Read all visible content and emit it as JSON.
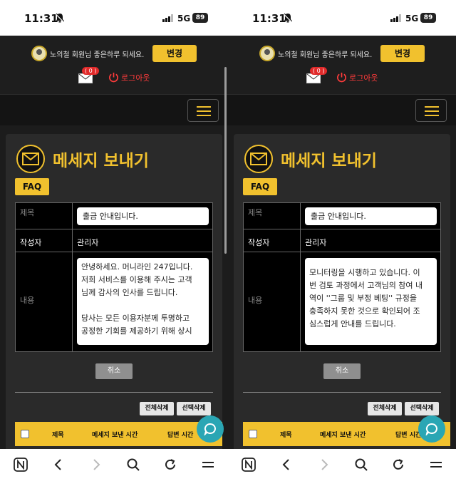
{
  "status": {
    "time": "11:31",
    "network": "5G",
    "battery": "89"
  },
  "header": {
    "greeting": "노의철 회원님 좋은하루 되세요.",
    "change_label": "변경",
    "mail_count": "( 0 )",
    "logout_label": "로그아웃"
  },
  "page": {
    "title": "메세지 보내기",
    "faq_label": "FAQ",
    "form": {
      "subject_label": "제목",
      "subject_value": "출금 안내입니다.",
      "author_label": "작성자",
      "author_value": "관리자",
      "content_label": "내용"
    },
    "cancel_label": "취소",
    "delete_all_label": "전체삭제",
    "delete_selected_label": "선택삭제",
    "list_columns": {
      "subject": "제목",
      "sent_time": "메세지 보낸 시간",
      "reply_time": "답변 시간"
    }
  },
  "panels": [
    {
      "content_lines": [
        "안녕하세요. 머니라인 247입니다.",
        "저희 서비스를 이용해 주시는 고객",
        "님께 감사의 인사를 드립니다.",
        "",
        "당사는 모든 이용자분께 투명하고",
        "공정한 기회를 제공하기 위해 상시"
      ]
    },
    {
      "content_lines": [
        "모니터링을 시행하고 있습니다. 이",
        "번 검토 과정에서 고객님의 참여 내",
        "역이 ''그룹 및 부정 베팅'' 규정을",
        "충족하지 못한 것으로 확인되어 조",
        "심스럽게 안내를 드립니다."
      ]
    }
  ],
  "colors": {
    "accent": "#f1c12e",
    "background": "#1c1c1c",
    "danger": "#e12a2a",
    "fab": "#2aa6b4"
  },
  "icons": [
    "bell-off-icon",
    "signal-icon",
    "avatar",
    "mail-icon",
    "power-icon",
    "menu-icon",
    "envelope-icon",
    "chat-icon",
    "n-logo-icon",
    "back-icon",
    "forward-icon",
    "search-icon",
    "reload-icon",
    "menu-icon"
  ]
}
